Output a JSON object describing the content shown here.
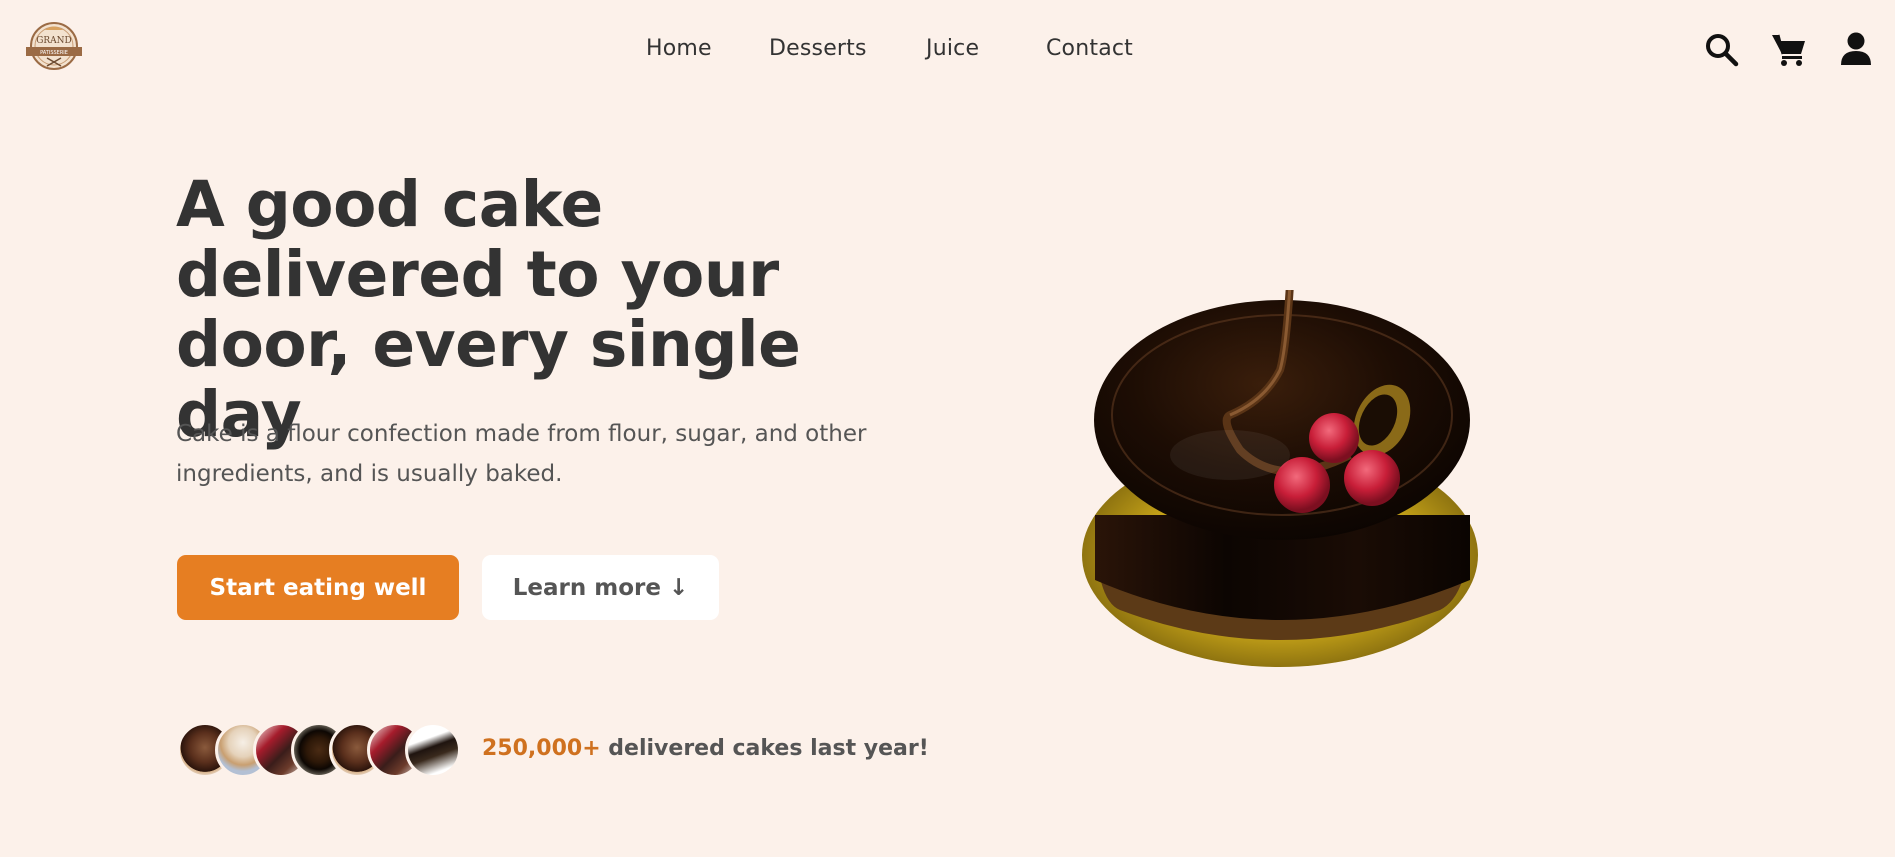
{
  "header": {
    "logo_text_top": "GRAND",
    "logo_text_bottom": "PATISSERIE",
    "nav": [
      {
        "label": "Home"
      },
      {
        "label": "Desserts"
      },
      {
        "label": "Juice"
      },
      {
        "label": "Contact"
      }
    ],
    "icons": [
      "search-icon",
      "cart-icon",
      "user-icon"
    ]
  },
  "hero": {
    "title": "A good cake delivered to your door, every single day",
    "description": "Cake is a flour confection made from flour, sugar, and other ingredients, and is usually baked.",
    "primary_button": "Start eating well",
    "secondary_button": "Learn more ↓",
    "delivered_count": "250,000+",
    "delivered_text": " delivered cakes last year!"
  },
  "colors": {
    "background": "#fcf1ea",
    "accent": "#e67e22",
    "text": "#333333"
  }
}
